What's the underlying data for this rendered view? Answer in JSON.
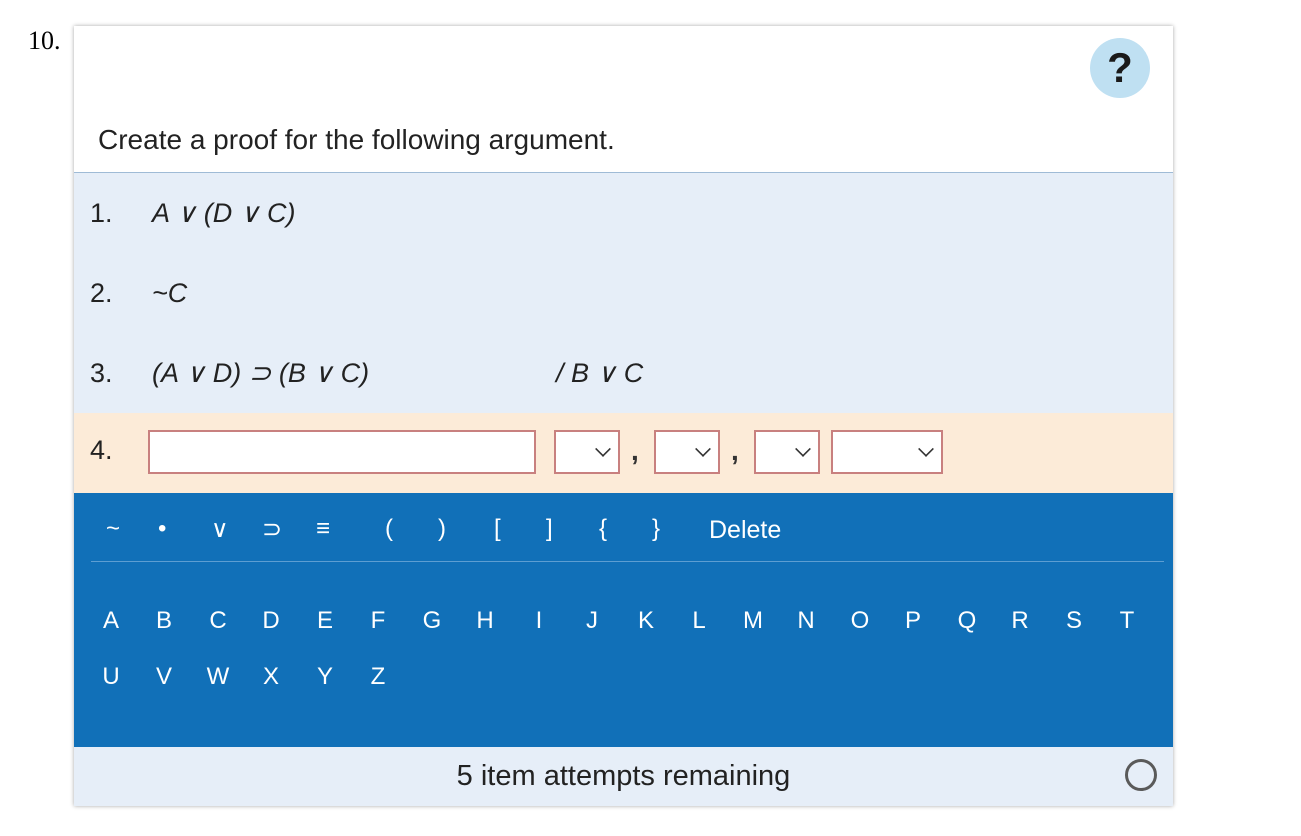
{
  "question_number": "10.",
  "help_label": "?",
  "prompt": "Create a proof for the following argument.",
  "premises": [
    {
      "number": "1.",
      "formula": "A ∨ (D ∨ C)"
    },
    {
      "number": "2.",
      "formula": "~C"
    },
    {
      "number": "3.",
      "formula": "(A ∨ D) ⊃ (B ∨ C)",
      "conclusion": "/ B ∨ C"
    }
  ],
  "answer_line": {
    "number": "4.",
    "formula_value": "",
    "rule_select_value": "",
    "line_ref_1_value": "",
    "line_ref_2_value": "",
    "line_ref_3_value": "",
    "separator": ","
  },
  "keyboard": {
    "symbols": [
      "~",
      "•",
      "∨",
      "⊃",
      "≡",
      "(",
      ")",
      "[",
      "]",
      "{",
      "}"
    ],
    "delete_label": "Delete",
    "letters": [
      "A",
      "B",
      "C",
      "D",
      "E",
      "F",
      "G",
      "H",
      "I",
      "J",
      "K",
      "L",
      "M",
      "N",
      "O",
      "P",
      "Q",
      "R",
      "S",
      "T",
      "U",
      "V",
      "W",
      "X",
      "Y",
      "Z"
    ]
  },
  "footer": {
    "attempts_text": "5 item attempts remaining"
  },
  "colors": {
    "premise_bg": "#e6eef8",
    "answer_bg": "#fcebd8",
    "keyboard_bg": "#1170b8",
    "input_border": "#c8807f",
    "help_bg": "#bfe0f2"
  },
  "icons": {
    "help": "question-mark-icon",
    "dropdown": "chevron-down-icon",
    "status": "empty-circle-icon"
  }
}
